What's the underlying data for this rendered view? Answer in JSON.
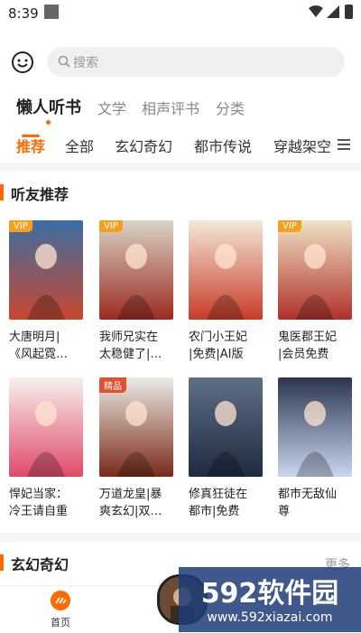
{
  "status": {
    "time": "8:39"
  },
  "search": {
    "placeholder": "搜索"
  },
  "top_tabs": [
    "懒人听书",
    "文学",
    "相声评书",
    "分类"
  ],
  "category_tabs": [
    "推荐",
    "全部",
    "玄幻奇幻",
    "都市传说",
    "穿越架空"
  ],
  "section1": {
    "title": "听友推荐",
    "books": [
      {
        "title_l1": "大唐明月|",
        "title_l2": "《风起霓…",
        "badge": "VIP",
        "badge_color": "#f4a21d",
        "colors": [
          "#3b6ea3",
          "#c8472f"
        ]
      },
      {
        "title_l1": "我师兄实在",
        "title_l2": "太稳健了|…",
        "badge": "VIP",
        "badge_color": "#f4a21d",
        "colors": [
          "#d9d3c7",
          "#9c2b20"
        ]
      },
      {
        "title_l1": "农门小王妃",
        "title_l2": "|免费|AI版",
        "badge": "",
        "badge_color": "",
        "colors": [
          "#f2ead7",
          "#c93b2a"
        ]
      },
      {
        "title_l1": "鬼医郡王妃",
        "title_l2": "|会员免费",
        "badge": "VIP",
        "badge_color": "#f4a21d",
        "colors": [
          "#efe3c4",
          "#b0302a"
        ]
      },
      {
        "title_l1": "悍妃当家：",
        "title_l2": "冷王请自重",
        "badge": "",
        "badge_color": "",
        "colors": [
          "#f6f1ee",
          "#e04a6a"
        ]
      },
      {
        "title_l1": "万道龙皇|暴",
        "title_l2": "爽玄幻|双…",
        "badge": "精品",
        "badge_color": "#e2502e",
        "colors": [
          "#ecebe6",
          "#7a2a1a"
        ]
      },
      {
        "title_l1": "修真狂徒在",
        "title_l2": "都市|免费",
        "badge": "",
        "badge_color": "",
        "colors": [
          "#5f6f86",
          "#1e2a40"
        ]
      },
      {
        "title_l1": "都市无敌仙",
        "title_l2": "尊",
        "badge": "",
        "badge_color": "",
        "colors": [
          "#2b3550",
          "#c9d6ef"
        ]
      }
    ]
  },
  "section2": {
    "title": "玄幻奇幻",
    "more": "更多"
  },
  "bottom_nav": {
    "home": "首页"
  },
  "watermark": {
    "brand": "592软件园",
    "url": "www.592xiazai.com"
  },
  "accent": "#ff6a00"
}
